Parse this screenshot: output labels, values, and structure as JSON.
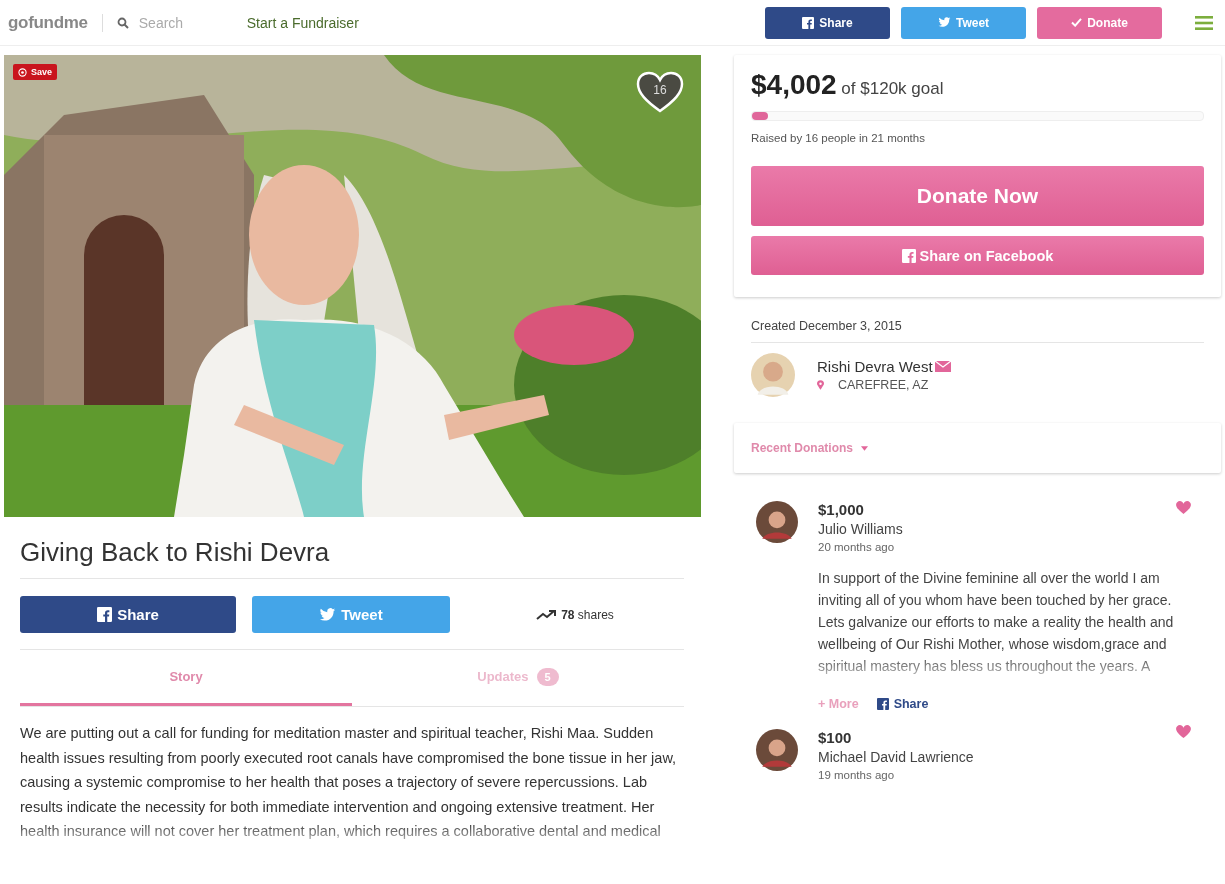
{
  "header": {
    "logo": "go**fundme**",
    "search": {
      "placeholder": "Search"
    },
    "start_link": "Start a Fundraiser",
    "buttons": [
      {
        "kind": "facebook",
        "label": "Share"
      },
      {
        "kind": "twitter",
        "label": "Tweet"
      },
      {
        "kind": "donate",
        "label": "Donate"
      }
    ]
  },
  "photo": {
    "kind": "picture",
    "save_label": "Save",
    "hearts": "16"
  },
  "campaign": {
    "title": "Giving Back to Rishi Devra",
    "share_buttons": [
      {
        "kind": "facebook",
        "label": "Share"
      },
      {
        "kind": "twitter",
        "label": "Tweet"
      }
    ],
    "shares_count": "78",
    "shares_label": "shares",
    "tabs": [
      {
        "label": "Story",
        "selected": true
      },
      {
        "label": "Updates",
        "selected": false,
        "badge": "5"
      }
    ],
    "story": "We are putting out a call for funding for meditation master and spiritual teacher, Rishi Maa.  Sudden health issues resulting from poorly executed root canals have compromised the bone tissue in her jaw, causing a systemic compromise to her health that poses a trajectory of severe repercussions.  Lab results indicate the necessity for both immediate intervention and ongoing extensive treatment.  Her health insurance will not cover her treatment plan, which requires a collaborative dental and medical"
  },
  "goal": {
    "raised": "$4,002",
    "of_goal": "of $120k goal",
    "level": 0.035,
    "raised_by": "Raised by 16 people in 21 months",
    "donate_button": "Donate Now",
    "share_button": "Share on Facebook"
  },
  "organizer": {
    "created": "Created December 3, 2015",
    "name": "Rishi Devra West",
    "location": "CAREFREE, AZ"
  },
  "recent_donations": {
    "label": "Recent Donations",
    "items": [
      {
        "amount": "$1,000",
        "name": "Julio Williams",
        "time": "20 months ago",
        "message": "In support of the Divine feminine all over the world I am inviting all of you whom have been touched by her grace. Lets galvanize our efforts to make a reality the health and wellbeing of Our Rishi Mother, whose wisdom,grace and spiritual mastery has bless us throughout the years. A",
        "more_link": "+ More",
        "share_link": "Share"
      },
      {
        "amount": "$100",
        "name": "Michael David Lawrience",
        "time": "19 months ago"
      }
    ]
  }
}
